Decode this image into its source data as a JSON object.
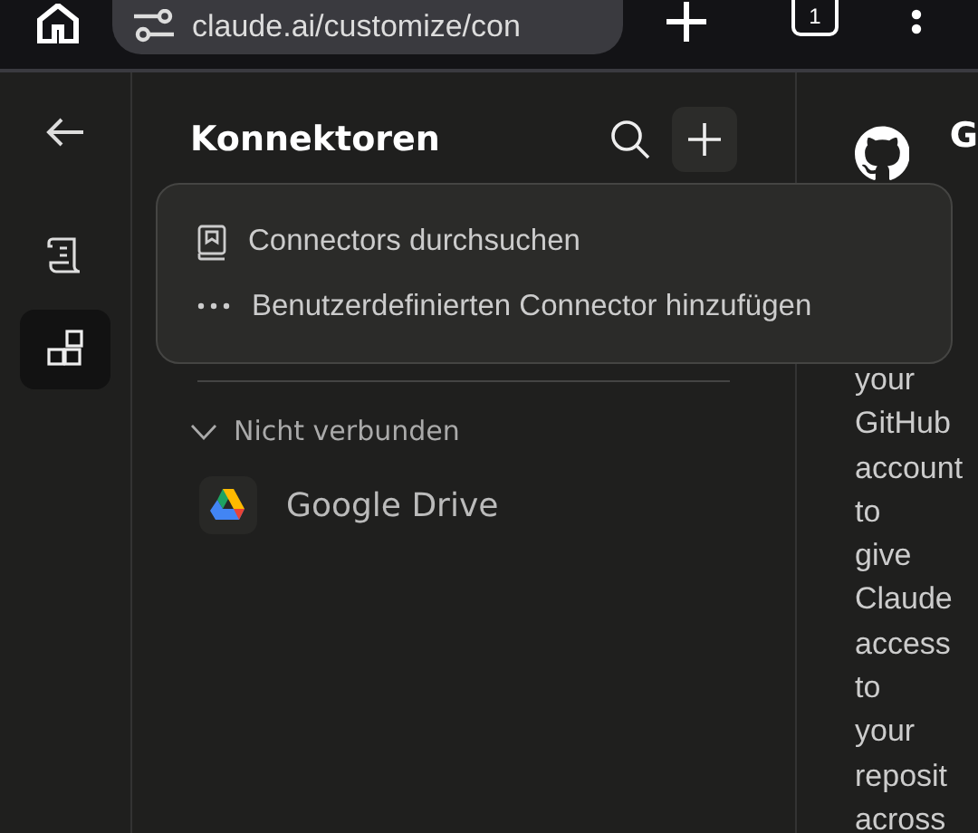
{
  "browser": {
    "url": "claude.ai/customize/con",
    "tab_count": "1"
  },
  "rail": [
    {
      "kind": "scroll",
      "selected": false
    },
    {
      "kind": "connectors",
      "selected": true
    }
  ],
  "panel": {
    "title": "Konnektoren"
  },
  "menu": [
    {
      "kind": "browse",
      "label": "Connectors durchsuchen"
    },
    {
      "kind": "more",
      "label": "Benutzerdefinierten Connector hinzufügen"
    }
  ],
  "section": {
    "label": "Nicht verbunden",
    "expanded": true
  },
  "connectors": [
    {
      "name": "Google Drive"
    }
  ],
  "detail": {
    "title": "G",
    "lines": [
      "your",
      "GitHub",
      "account",
      "to",
      "give",
      "Claude",
      "access",
      "to",
      "your",
      "reposit",
      "across"
    ]
  }
}
